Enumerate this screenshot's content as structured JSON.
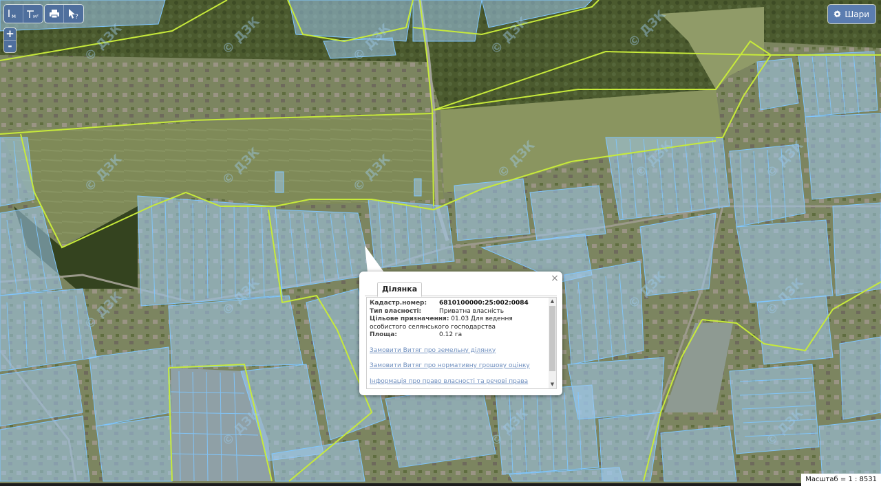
{
  "toolbar": {
    "measure_length_label": "м",
    "measure_area_label": "м²"
  },
  "zoom": {
    "in_label": "+",
    "out_label": "-"
  },
  "layers_button": {
    "label": "Шари"
  },
  "watermark": "© ДЗК",
  "popup": {
    "tab_label": "Ділянка",
    "close_label": "×",
    "cadastral_label": "Кадастр.номер:",
    "cadastral_value": "6810100000:25:002:0084",
    "ownership_label": "Тип власності:",
    "ownership_value": "Приватна власність",
    "purpose_label": "Цільове призначення:",
    "purpose_value": "01.03 Для ведення особистого селянського господарства",
    "area_label": "Площа:",
    "area_value": "0.12 га",
    "links": [
      "Замовити Витяг про земельну ділянку",
      "Замовити Витяг про нормативну грошову оцінку",
      "Інформація про право власності та речові права"
    ]
  },
  "scale_text": "Масштаб = 1 : 8531",
  "colors": {
    "parcel_fill": "#9ec9ec",
    "parcel_stroke": "#7fc6ff",
    "boundary_line": "#c7ea3a",
    "button_blue": "#4f6f9d"
  }
}
